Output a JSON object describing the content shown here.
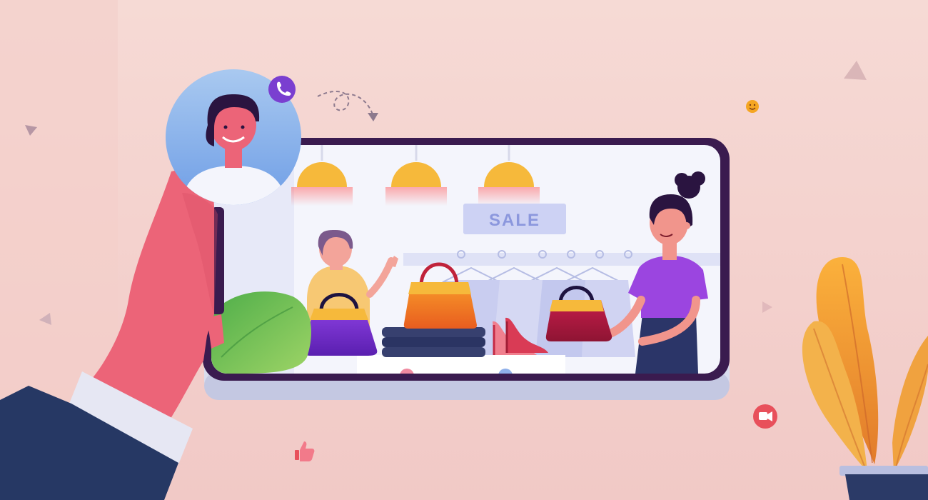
{
  "scene": {
    "store_sign": "SALE",
    "caller_badge_icon": "phone-icon",
    "floating_icons": [
      "smiley-icon",
      "video-call-icon",
      "thumbs-up-icon"
    ],
    "colors": {
      "background": "#f4d3ce",
      "phone_frame": "#3a1b4f",
      "phone_base": "#d9dcee",
      "sign_bg": "#cdd2f4",
      "sign_text": "#8b97dd",
      "call_badge": "#7a3fd0",
      "video_badge": "#e8505b",
      "lamp": "#f6b93b",
      "sleeve": "#263864",
      "plant_leaf": "#f2a93b",
      "plant_pot": "#2b3a67"
    }
  }
}
